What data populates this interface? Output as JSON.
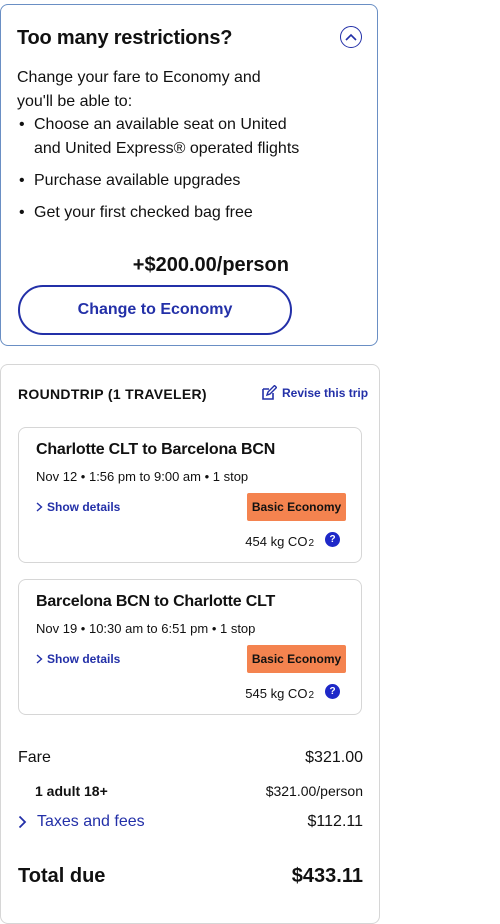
{
  "upsell": {
    "title": "Too many restrictions?",
    "intro": "Change your fare to Economy and you'll be able to:",
    "benefits": [
      "Choose an available seat on United and United Express® operated flights",
      "Purchase available upgrades",
      "Get your first checked bag free"
    ],
    "price_delta": "+$200.00/person",
    "cta_label": "Change to Economy",
    "toggle_icon": "chevron-up-icon"
  },
  "trip": {
    "heading": "ROUNDTRIP (1 TRAVELER)",
    "revise_label": "Revise this trip",
    "flights": [
      {
        "route": "Charlotte CLT to Barcelona BCN",
        "time": "Nov 12 • 1:56 pm to 9:00 am • 1 stop",
        "details_label": "Show details",
        "fare_class": "Basic Economy",
        "co2_value": "454 kg CO",
        "co2_sub": "2"
      },
      {
        "route": "Barcelona BCN to Charlotte CLT",
        "time": "Nov 19 • 10:30 am to 6:51 pm • 1 stop",
        "details_label": "Show details",
        "fare_class": "Basic Economy",
        "co2_value": "545 kg CO",
        "co2_sub": "2"
      }
    ]
  },
  "pricing": {
    "fare_label": "Fare",
    "fare_value": "$321.00",
    "adult_label": "1 adult 18+",
    "adult_value": "$321.00/person",
    "taxes_label": "Taxes and fees",
    "taxes_value": "$112.11",
    "total_label": "Total due",
    "total_value": "$433.11"
  },
  "colors": {
    "accent": "#2330a8",
    "badge": "#f4834f",
    "help": "#1e28c8"
  }
}
